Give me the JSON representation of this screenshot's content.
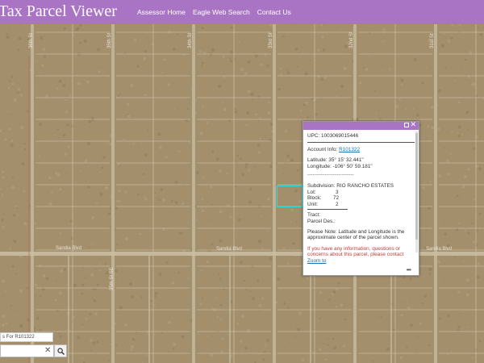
{
  "header": {
    "title": "Tax Parcel Viewer",
    "nav": [
      "Assessor Home",
      "Eagle Web Search",
      "Contact Us"
    ]
  },
  "map": {
    "road_labels_horizontal": [
      "Sandia Blvd",
      "Sandia Blvd",
      "Sandia Blvd"
    ],
    "road_labels_vertical": [
      "36th St",
      "35th St",
      "34th St",
      "33rd St",
      "32nd St",
      "31st St",
      "35th St SE"
    ]
  },
  "popup": {
    "upc": "UPC: 1003069015446",
    "account_label": "Account Info:",
    "account_link": "R101322",
    "latitude": "Latitude: 35° 15' 32.441\"",
    "longitude": "Longitude: -106° 50' 59.181\"",
    "dashes": "---------------------------",
    "subdivision": "Subdivision: RIO RANCHO ESTATES",
    "lot_label": "Lot:",
    "lot_value": "3",
    "block_label": "Block:",
    "block_value": "72",
    "unit_label": "Unit:",
    "unit_value": "2",
    "tract": "Tract:",
    "parcel_des": "Parcel Des.:",
    "note": "Please Note: Latitude and Longitude is the approximate center of the parcel shown.",
    "contact": "If you have any information, questions or concerns about this parcel, please contact",
    "zoom": "Zoom to"
  },
  "search": {
    "result_text": "s For R101322",
    "clear_glyph": "✕"
  },
  "colors": {
    "header": "#a974c3",
    "selection": "#2fd7d9",
    "terrain": "#a4906c"
  }
}
